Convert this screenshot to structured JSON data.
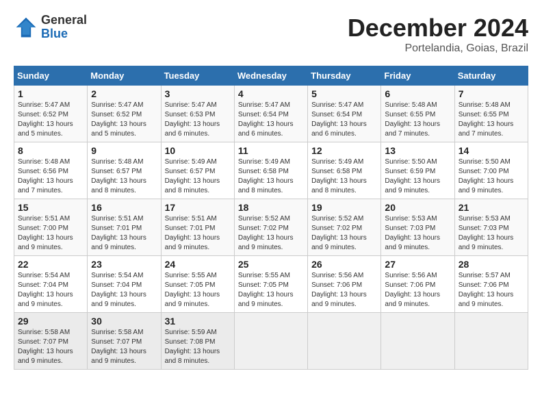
{
  "logo": {
    "general": "General",
    "blue": "Blue"
  },
  "title": "December 2024",
  "location": "Portelandia, Goias, Brazil",
  "weekdays": [
    "Sunday",
    "Monday",
    "Tuesday",
    "Wednesday",
    "Thursday",
    "Friday",
    "Saturday"
  ],
  "weeks": [
    [
      {
        "day": "1",
        "sunrise": "Sunrise: 5:47 AM",
        "sunset": "Sunset: 6:52 PM",
        "daylight": "Daylight: 13 hours and 5 minutes."
      },
      {
        "day": "2",
        "sunrise": "Sunrise: 5:47 AM",
        "sunset": "Sunset: 6:52 PM",
        "daylight": "Daylight: 13 hours and 5 minutes."
      },
      {
        "day": "3",
        "sunrise": "Sunrise: 5:47 AM",
        "sunset": "Sunset: 6:53 PM",
        "daylight": "Daylight: 13 hours and 6 minutes."
      },
      {
        "day": "4",
        "sunrise": "Sunrise: 5:47 AM",
        "sunset": "Sunset: 6:54 PM",
        "daylight": "Daylight: 13 hours and 6 minutes."
      },
      {
        "day": "5",
        "sunrise": "Sunrise: 5:47 AM",
        "sunset": "Sunset: 6:54 PM",
        "daylight": "Daylight: 13 hours and 6 minutes."
      },
      {
        "day": "6",
        "sunrise": "Sunrise: 5:48 AM",
        "sunset": "Sunset: 6:55 PM",
        "daylight": "Daylight: 13 hours and 7 minutes."
      },
      {
        "day": "7",
        "sunrise": "Sunrise: 5:48 AM",
        "sunset": "Sunset: 6:55 PM",
        "daylight": "Daylight: 13 hours and 7 minutes."
      }
    ],
    [
      {
        "day": "8",
        "sunrise": "Sunrise: 5:48 AM",
        "sunset": "Sunset: 6:56 PM",
        "daylight": "Daylight: 13 hours and 7 minutes."
      },
      {
        "day": "9",
        "sunrise": "Sunrise: 5:48 AM",
        "sunset": "Sunset: 6:57 PM",
        "daylight": "Daylight: 13 hours and 8 minutes."
      },
      {
        "day": "10",
        "sunrise": "Sunrise: 5:49 AM",
        "sunset": "Sunset: 6:57 PM",
        "daylight": "Daylight: 13 hours and 8 minutes."
      },
      {
        "day": "11",
        "sunrise": "Sunrise: 5:49 AM",
        "sunset": "Sunset: 6:58 PM",
        "daylight": "Daylight: 13 hours and 8 minutes."
      },
      {
        "day": "12",
        "sunrise": "Sunrise: 5:49 AM",
        "sunset": "Sunset: 6:58 PM",
        "daylight": "Daylight: 13 hours and 8 minutes."
      },
      {
        "day": "13",
        "sunrise": "Sunrise: 5:50 AM",
        "sunset": "Sunset: 6:59 PM",
        "daylight": "Daylight: 13 hours and 9 minutes."
      },
      {
        "day": "14",
        "sunrise": "Sunrise: 5:50 AM",
        "sunset": "Sunset: 7:00 PM",
        "daylight": "Daylight: 13 hours and 9 minutes."
      }
    ],
    [
      {
        "day": "15",
        "sunrise": "Sunrise: 5:51 AM",
        "sunset": "Sunset: 7:00 PM",
        "daylight": "Daylight: 13 hours and 9 minutes."
      },
      {
        "day": "16",
        "sunrise": "Sunrise: 5:51 AM",
        "sunset": "Sunset: 7:01 PM",
        "daylight": "Daylight: 13 hours and 9 minutes."
      },
      {
        "day": "17",
        "sunrise": "Sunrise: 5:51 AM",
        "sunset": "Sunset: 7:01 PM",
        "daylight": "Daylight: 13 hours and 9 minutes."
      },
      {
        "day": "18",
        "sunrise": "Sunrise: 5:52 AM",
        "sunset": "Sunset: 7:02 PM",
        "daylight": "Daylight: 13 hours and 9 minutes."
      },
      {
        "day": "19",
        "sunrise": "Sunrise: 5:52 AM",
        "sunset": "Sunset: 7:02 PM",
        "daylight": "Daylight: 13 hours and 9 minutes."
      },
      {
        "day": "20",
        "sunrise": "Sunrise: 5:53 AM",
        "sunset": "Sunset: 7:03 PM",
        "daylight": "Daylight: 13 hours and 9 minutes."
      },
      {
        "day": "21",
        "sunrise": "Sunrise: 5:53 AM",
        "sunset": "Sunset: 7:03 PM",
        "daylight": "Daylight: 13 hours and 9 minutes."
      }
    ],
    [
      {
        "day": "22",
        "sunrise": "Sunrise: 5:54 AM",
        "sunset": "Sunset: 7:04 PM",
        "daylight": "Daylight: 13 hours and 9 minutes."
      },
      {
        "day": "23",
        "sunrise": "Sunrise: 5:54 AM",
        "sunset": "Sunset: 7:04 PM",
        "daylight": "Daylight: 13 hours and 9 minutes."
      },
      {
        "day": "24",
        "sunrise": "Sunrise: 5:55 AM",
        "sunset": "Sunset: 7:05 PM",
        "daylight": "Daylight: 13 hours and 9 minutes."
      },
      {
        "day": "25",
        "sunrise": "Sunrise: 5:55 AM",
        "sunset": "Sunset: 7:05 PM",
        "daylight": "Daylight: 13 hours and 9 minutes."
      },
      {
        "day": "26",
        "sunrise": "Sunrise: 5:56 AM",
        "sunset": "Sunset: 7:06 PM",
        "daylight": "Daylight: 13 hours and 9 minutes."
      },
      {
        "day": "27",
        "sunrise": "Sunrise: 5:56 AM",
        "sunset": "Sunset: 7:06 PM",
        "daylight": "Daylight: 13 hours and 9 minutes."
      },
      {
        "day": "28",
        "sunrise": "Sunrise: 5:57 AM",
        "sunset": "Sunset: 7:06 PM",
        "daylight": "Daylight: 13 hours and 9 minutes."
      }
    ],
    [
      {
        "day": "29",
        "sunrise": "Sunrise: 5:58 AM",
        "sunset": "Sunset: 7:07 PM",
        "daylight": "Daylight: 13 hours and 9 minutes."
      },
      {
        "day": "30",
        "sunrise": "Sunrise: 5:58 AM",
        "sunset": "Sunset: 7:07 PM",
        "daylight": "Daylight: 13 hours and 9 minutes."
      },
      {
        "day": "31",
        "sunrise": "Sunrise: 5:59 AM",
        "sunset": "Sunset: 7:08 PM",
        "daylight": "Daylight: 13 hours and 8 minutes."
      },
      null,
      null,
      null,
      null
    ]
  ]
}
